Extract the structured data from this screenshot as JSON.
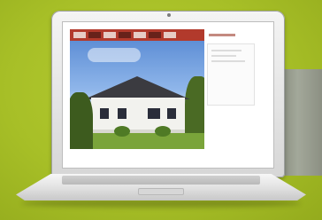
{
  "colors": {
    "background": "#a9c12a",
    "site_header": "#b23a2c",
    "laptop_body": "#e3e3e3"
  },
  "icons": [
    "laptop-icon",
    "house-photo"
  ]
}
